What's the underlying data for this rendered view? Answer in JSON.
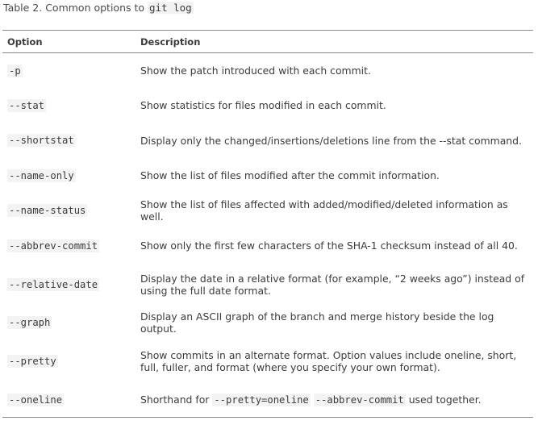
{
  "caption": {
    "prefix": "Table 2. Common options to ",
    "code": "git log"
  },
  "table": {
    "headers": [
      "Option",
      "Description"
    ],
    "rows": [
      {
        "option": "-p",
        "description": "Show the patch introduced with each commit."
      },
      {
        "option": "--stat",
        "description": "Show statistics for files modified in each commit."
      },
      {
        "option": "--shortstat",
        "description": "Display only the changed/insertions/deletions line from the --stat command."
      },
      {
        "option": "--name-only",
        "description": "Show the list of files modified after the commit information."
      },
      {
        "option": "--name-status",
        "description": "Show the list of files affected with added/modified/deleted information as well."
      },
      {
        "option": "--abbrev-commit",
        "description": "Show only the first few characters of the SHA-1 checksum instead of all 40."
      },
      {
        "option": "--relative-date",
        "description": "Display the date in a relative format (for example, “2 weeks ago”) instead of using the full date format."
      },
      {
        "option": "--graph",
        "description": "Display an ASCII graph of the branch and merge history beside the log output."
      },
      {
        "option": "--pretty",
        "description": "Show commits in an alternate format. Option values include oneline, short, full, fuller, and format (where you specify your own format)."
      },
      {
        "option": "--oneline",
        "description_prefix": "Shorthand for ",
        "description_code_1": "--pretty=oneline",
        "description_middle": " ",
        "description_code_2": "--abbrev-commit",
        "description_suffix": " used together."
      }
    ]
  }
}
